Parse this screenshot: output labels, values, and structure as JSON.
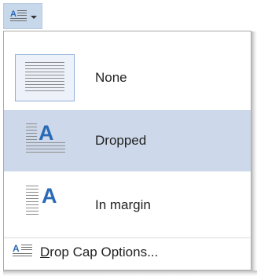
{
  "ribbon": {
    "button_icon": "drop-cap-icon",
    "arrow_icon": "chevron-down-icon"
  },
  "menu": {
    "items": [
      {
        "label": "None",
        "icon": "no-drop-cap-icon",
        "selected": false
      },
      {
        "label": "Dropped",
        "icon": "dropped-cap-icon",
        "selected": true
      },
      {
        "label": "In margin",
        "icon": "in-margin-cap-icon",
        "selected": false
      }
    ],
    "options": {
      "label_mnemonic": "D",
      "label_rest": "rop Cap Options...",
      "icon": "drop-cap-options-icon"
    }
  },
  "colors": {
    "selected_background": "#cdd9ea",
    "accent_blue": "#2a6ab6",
    "line_gray": "#8c8c8c"
  }
}
